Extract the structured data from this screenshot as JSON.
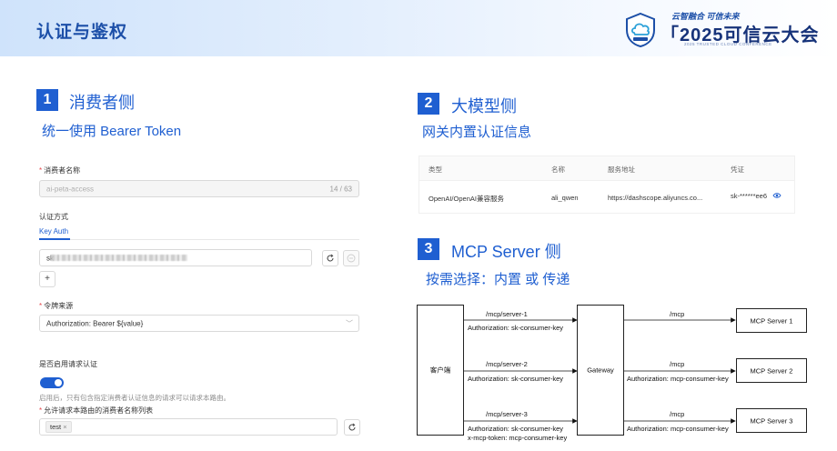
{
  "header": {
    "title": "认证与鉴权",
    "conference": {
      "slogan": "云智融合 可信未来",
      "name": "「2025可信云大会",
      "english": "2025 TRUSTED CLOUD CONFERENCE"
    }
  },
  "section1": {
    "number": "1",
    "title": "消费者侧",
    "subtitle": "统一使用 Bearer Token",
    "form": {
      "consumer_name_label": "消费者名称",
      "consumer_name_value": "ai-peta-access",
      "consumer_name_count": "14 / 63",
      "auth_method_label": "认证方式",
      "tab_key_auth": "Key Auth",
      "key_prefix": "sk",
      "add_symbol": "+",
      "token_source_label": "令牌来源",
      "token_source_value": "Authorization: Bearer ${value}",
      "enable_auth_label": "是否启用请求认证",
      "enable_auth_hint": "启用后，只有包含指定消费者认证信息的请求可以请求本路由。",
      "allowed_consumers_label": "允许请求本路由的消费者名称列表",
      "allowed_tag": "test",
      "tag_close": "×"
    }
  },
  "section2": {
    "number": "2",
    "title": "大模型侧",
    "subtitle": "网关内置认证信息",
    "table": {
      "headers": [
        "类型",
        "名称",
        "服务地址",
        "凭证"
      ],
      "row": [
        "OpenAI/OpenAI兼容服务",
        "ali_qwen",
        "https://dashscope.aliyuncs.co...",
        "sk-******ee6"
      ]
    }
  },
  "section3": {
    "number": "3",
    "title": "MCP Server 侧",
    "subtitle": "按需选择：内置 或 传递",
    "diagram": {
      "client": "客户端",
      "gateway": "Gateway",
      "servers": [
        "MCP Server 1",
        "MCP Server 2",
        "MCP Server 3"
      ],
      "left_paths": [
        "/mcp/server-1",
        "/mcp/server-2",
        "/mcp/server-3"
      ],
      "left_headers": [
        "Authorization: sk-consumer-key",
        "Authorization: sk-consumer-key",
        "Authorization: sk-consumer-key"
      ],
      "left_extra": "x-mcp-token: mcp-consumer-key",
      "right_path": "/mcp",
      "right_headers": [
        "",
        "Authorization: mcp-consumer-key",
        "Authorization: mcp-consumer-key"
      ]
    }
  },
  "colors": {
    "accent": "#1f5fd1",
    "header_text": "#1c4fa8"
  }
}
